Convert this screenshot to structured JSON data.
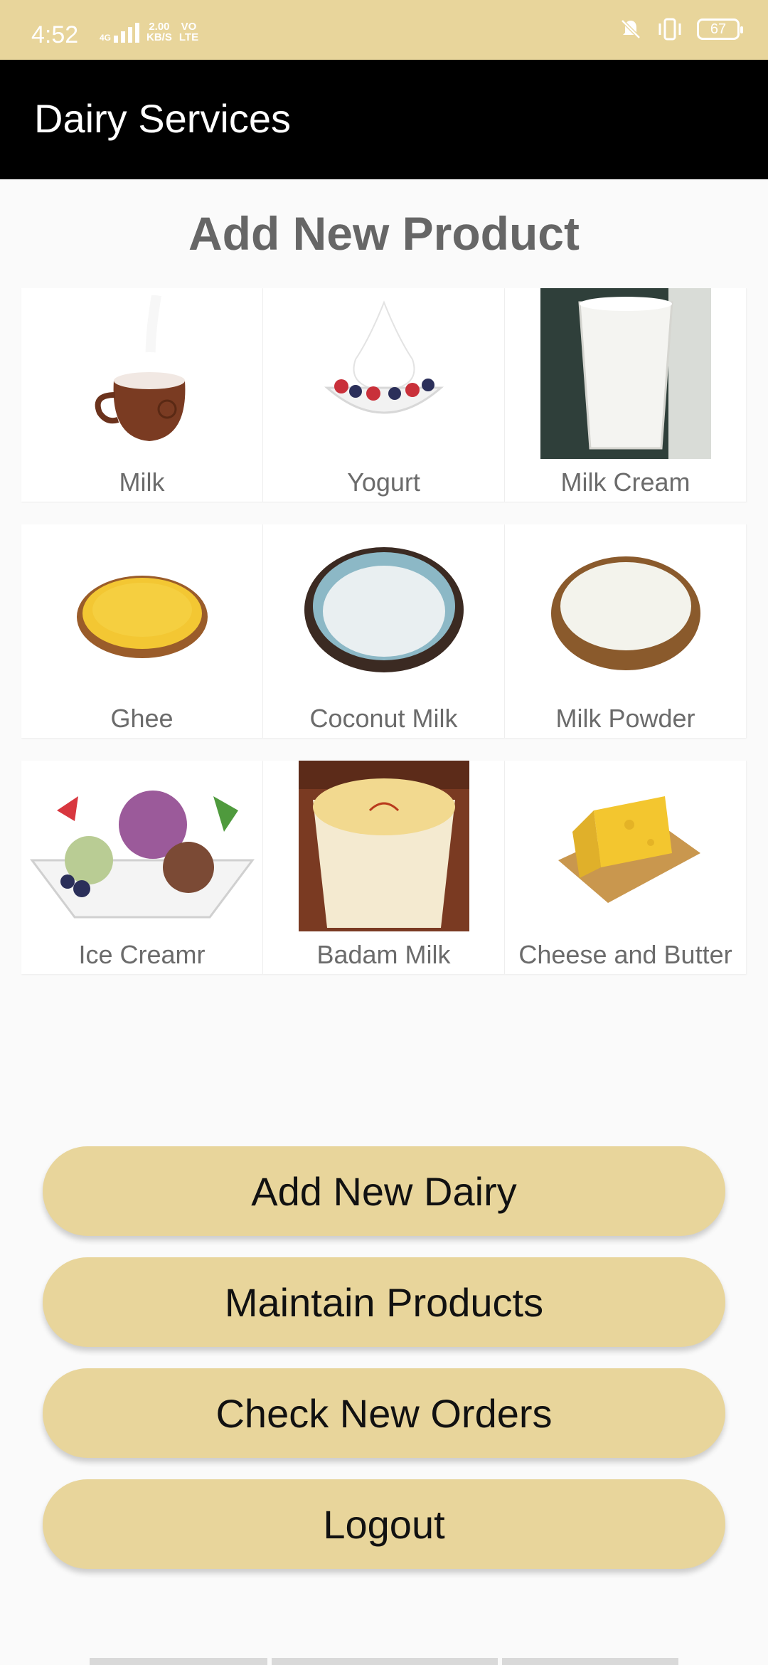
{
  "status_bar": {
    "time": "4:52",
    "network_label": "4G",
    "speed_value": "2.00",
    "speed_unit": "KB/S",
    "volte_top": "VO",
    "volte_bottom": "LTE",
    "battery": "67"
  },
  "app_bar": {
    "title": "Dairy Services"
  },
  "main": {
    "title": "Add New Product",
    "products": [
      {
        "label": "Milk",
        "icon": "milk-jug-icon"
      },
      {
        "label": "Yogurt",
        "icon": "yogurt-bowl-icon"
      },
      {
        "label": "Milk Cream",
        "icon": "milk-cream-glass-icon"
      },
      {
        "label": "Ghee",
        "icon": "ghee-tart-icon"
      },
      {
        "label": "Coconut Milk",
        "icon": "coconut-milk-bowl-icon"
      },
      {
        "label": "Milk Powder",
        "icon": "milk-powder-bowl-icon"
      },
      {
        "label": "Ice Creamr",
        "icon": "ice-cream-plate-icon"
      },
      {
        "label": "Badam Milk",
        "icon": "badam-milk-glass-icon"
      },
      {
        "label": "Cheese and Butter",
        "icon": "cheese-board-icon"
      }
    ]
  },
  "buttons": {
    "add_dairy": "Add New Dairy",
    "maintain_products": "Maintain Products",
    "check_orders": "Check New Orders",
    "logout": "Logout"
  },
  "colors": {
    "accent": "#e8d59b",
    "app_bar": "#000000",
    "title_gray": "#666666"
  }
}
